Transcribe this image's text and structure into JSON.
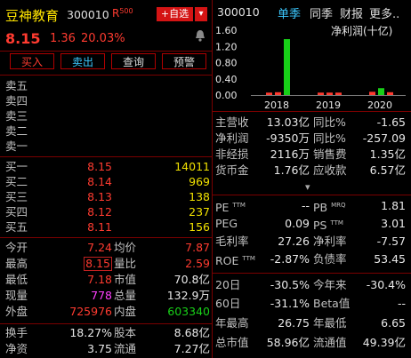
{
  "header": {
    "name": "豆神教育",
    "code": "300010",
    "r_badge": "R",
    "r_num": "500",
    "add_label": "+自选",
    "dropdown": "▾",
    "price": "8.15",
    "change": "1.36",
    "pct": "20.03%"
  },
  "actions": [
    "买入",
    "卖出",
    "查询",
    "预警"
  ],
  "sell_labels": [
    "卖五",
    "卖四",
    "卖三",
    "卖二",
    "卖一"
  ],
  "buy_book": [
    {
      "label": "买一",
      "price": "8.15",
      "vol": "14011"
    },
    {
      "label": "买二",
      "price": "8.14",
      "vol": "969"
    },
    {
      "label": "买三",
      "price": "8.13",
      "vol": "138"
    },
    {
      "label": "买四",
      "price": "8.12",
      "vol": "237"
    },
    {
      "label": "买五",
      "price": "8.11",
      "vol": "156"
    }
  ],
  "quote": [
    {
      "l1": "今开",
      "v1": "7.24",
      "l2": "均价",
      "v2": "7.87"
    },
    {
      "l1": "最高",
      "v1": "8.15",
      "l2": "量比",
      "v2": "2.59"
    },
    {
      "l1": "最低",
      "v1": "7.18",
      "l2": "市值",
      "v2": "70.8亿"
    },
    {
      "l1": "现量",
      "v1": "778",
      "l2": "总量",
      "v2": "132.9万"
    },
    {
      "l1": "外盘",
      "v1": "725976",
      "l2": "内盘",
      "v2": "603340"
    },
    {
      "l1": "换手",
      "v1": "18.27%",
      "l2": "股本",
      "v2": "8.68亿"
    },
    {
      "l1": "净资",
      "v1": "3.75",
      "l2": "流通",
      "v2": "7.27亿"
    }
  ],
  "right_header": {
    "code": "300010",
    "tabs": [
      "单季",
      "同季",
      "财报",
      "更多.."
    ]
  },
  "chart_data": {
    "type": "bar",
    "title": "净利润(十亿)",
    "categories": [
      "2018",
      "2019",
      "2020"
    ],
    "y_ticks": [
      "1.60",
      "1.20",
      "0.80",
      "0.40",
      "0.00"
    ],
    "ylim": [
      0,
      1.6
    ],
    "series": [
      {
        "values": [
          0.06,
          0.07,
          1.38,
          0.06,
          0.06,
          0.06,
          0.08,
          0.17,
          0.07
        ]
      }
    ],
    "colors": [
      "#ff3b30",
      "#ff3b30",
      "#18d018",
      "#ff3b30",
      "#ff3b30",
      "#ff3b30",
      "#ff3b30",
      "#18d018",
      "#ff3b30"
    ]
  },
  "fin": [
    {
      "l1": "主营收",
      "v1": "13.03亿",
      "l2": "同比%",
      "v2": "-1.65"
    },
    {
      "l1": "净利润",
      "v1": "-9350万",
      "l2": "同比%",
      "v2": "-257.09"
    },
    {
      "l1": "非经损",
      "v1": "2116万",
      "l2": "销售费",
      "v2": "1.35亿"
    },
    {
      "l1": "货币金",
      "v1": "1.76亿",
      "l2": "应收款",
      "v2": "6.57亿"
    }
  ],
  "expand_arrow": "▾",
  "valuation": [
    {
      "l1": "PE",
      "s1": "TTM",
      "v1": "--",
      "l2": "PB",
      "s2": "MRQ",
      "v2": "1.81"
    },
    {
      "l1": "PEG",
      "s1": "",
      "v1": "0.09",
      "l2": "PS",
      "s2": "TTM",
      "v2": "3.01"
    },
    {
      "l1": "毛利率",
      "s1": "",
      "v1": "27.26",
      "l2": "净利率",
      "s2": "",
      "v2": "-7.57"
    },
    {
      "l1": "ROE",
      "s1": "TTM",
      "v1": "-2.87%",
      "l2": "负债率",
      "s2": "",
      "v2": "53.45"
    }
  ],
  "perf": [
    {
      "l1": "20日",
      "v1": "-30.5%",
      "l2": "今年来",
      "v2": "-30.4%"
    },
    {
      "l1": "60日",
      "v1": "-31.1%",
      "l2": "Beta值",
      "v2": "--"
    },
    {
      "l1": "年最高",
      "v1": "26.75",
      "l2": "年最低",
      "v2": "6.65"
    },
    {
      "l1": "总市值",
      "v1": "58.96亿",
      "l2": "流通值",
      "v2": "49.39亿"
    }
  ]
}
